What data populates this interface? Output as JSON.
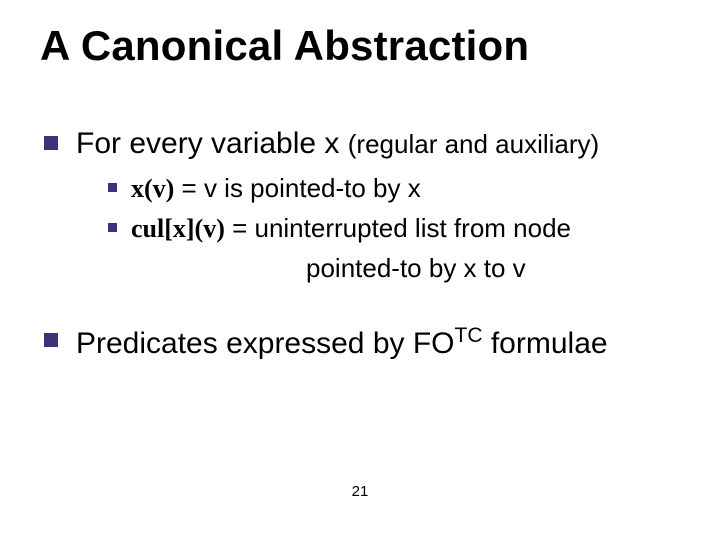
{
  "title": "A Canonical Abstraction",
  "bullets": {
    "b1": {
      "prefix": "For every variable x ",
      "aux": "(regular and auxiliary)",
      "sub": {
        "s1": {
          "pred": "x(v)",
          "rest": " = v is pointed-to by x"
        },
        "s2": {
          "pred": "cul[x](v)",
          "rest_line1": " = uninterrupted list from node",
          "rest_line2": "pointed-to by x to v"
        }
      }
    },
    "b2": {
      "before_sup": "Predicates expressed by FO",
      "sup": "TC",
      "after_sup": " formulae"
    }
  },
  "page_number": "21"
}
